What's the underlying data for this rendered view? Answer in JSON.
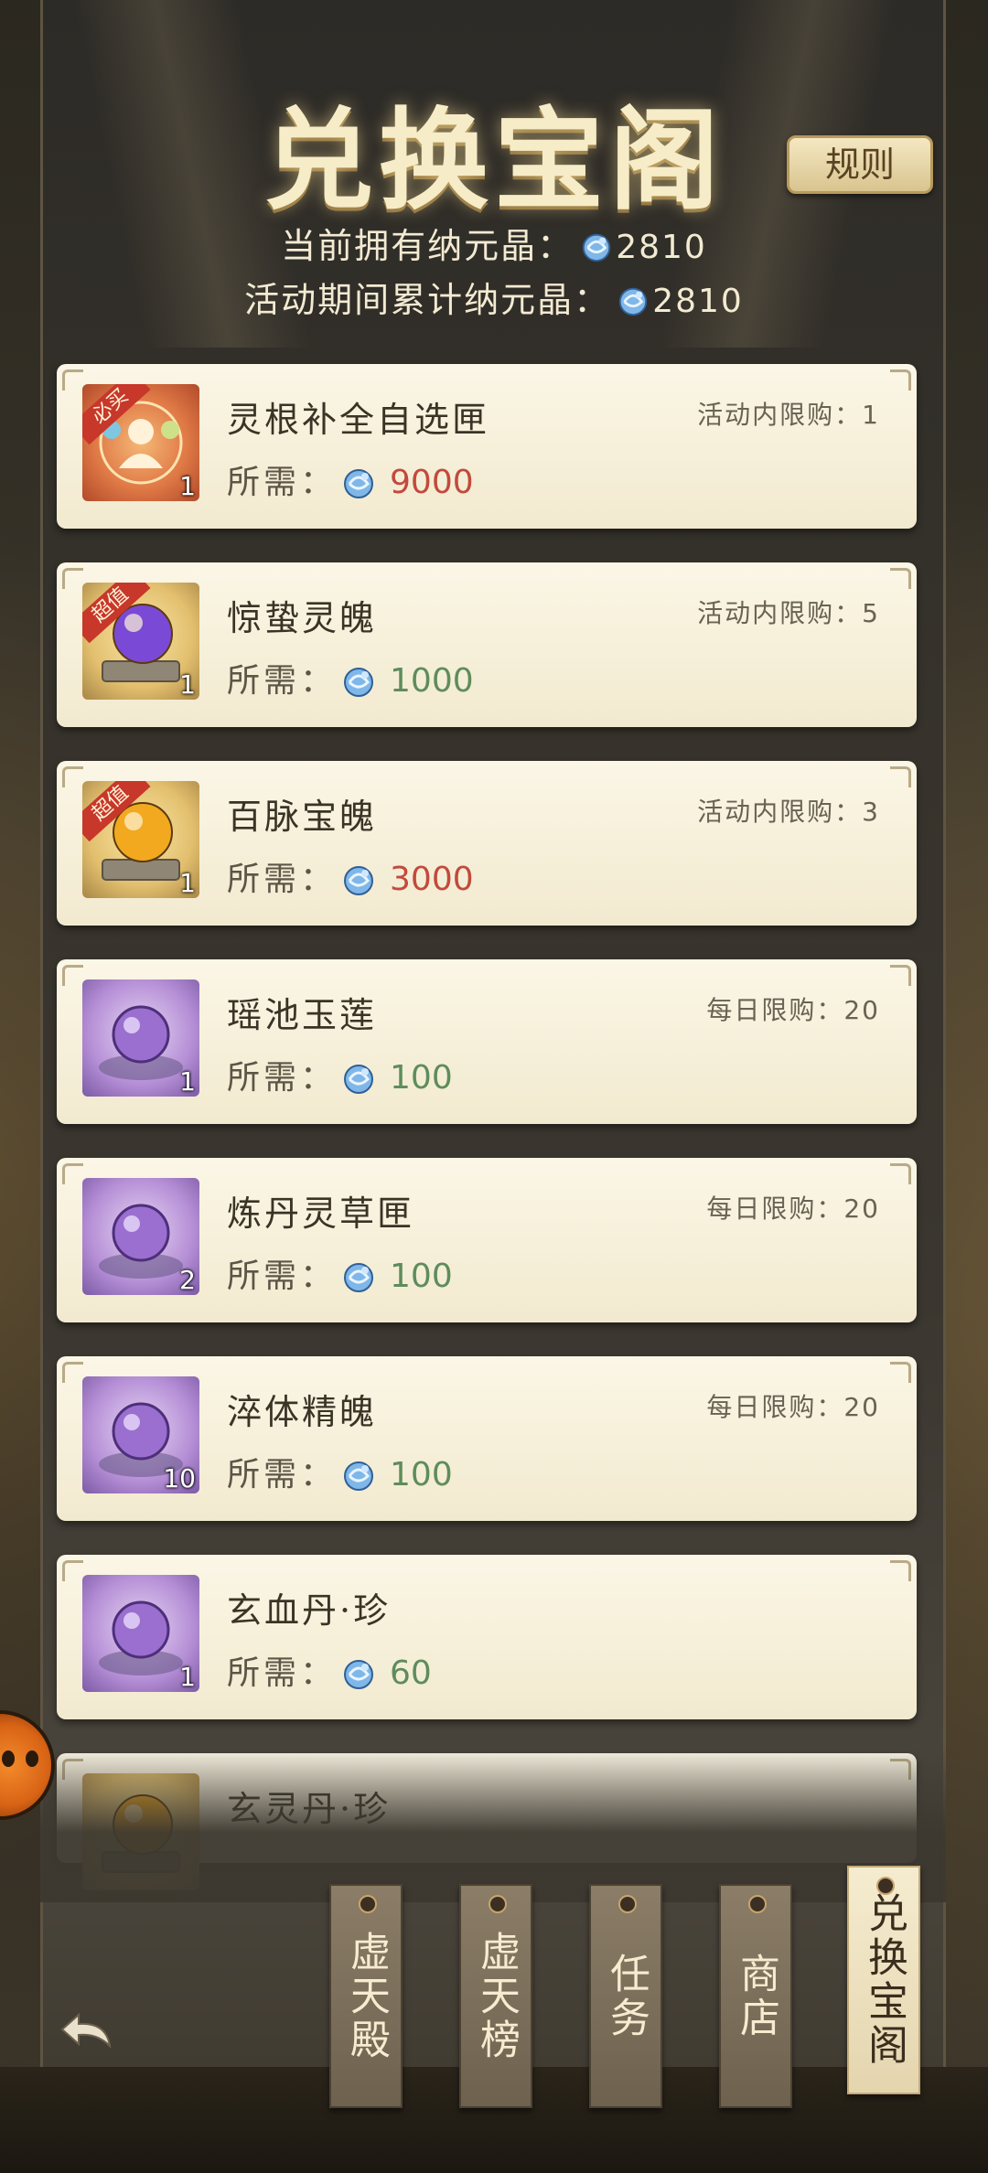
{
  "header": {
    "title": "兑换宝阁",
    "rules_label": "规则",
    "current_label": "当前拥有纳元晶：",
    "current_value": "2810",
    "total_label": "活动期间累计纳元晶：",
    "total_value": "2810"
  },
  "need_label": "所需：",
  "items": [
    {
      "name": "灵根补全自选匣",
      "price": "9000",
      "price_color": "red",
      "limit_label": "活动内限购：",
      "limit": "1",
      "count": "1",
      "tag": "必买",
      "thumb": "red"
    },
    {
      "name": "惊蛰灵魄",
      "price": "1000",
      "price_color": "green",
      "limit_label": "活动内限购：",
      "limit": "5",
      "count": "1",
      "tag": "超值",
      "thumb": "gold"
    },
    {
      "name": "百脉宝魄",
      "price": "3000",
      "price_color": "red",
      "limit_label": "活动内限购：",
      "limit": "3",
      "count": "1",
      "tag": "超值",
      "thumb": "gold"
    },
    {
      "name": "瑶池玉莲",
      "price": "100",
      "price_color": "green",
      "limit_label": "每日限购：",
      "limit": "20",
      "count": "1",
      "tag": "",
      "thumb": "purple"
    },
    {
      "name": "炼丹灵草匣",
      "price": "100",
      "price_color": "green",
      "limit_label": "每日限购：",
      "limit": "20",
      "count": "2",
      "tag": "",
      "thumb": "purple"
    },
    {
      "name": "淬体精魄",
      "price": "100",
      "price_color": "green",
      "limit_label": "每日限购：",
      "limit": "20",
      "count": "10",
      "tag": "",
      "thumb": "purple"
    },
    {
      "name": "玄血丹·珍",
      "price": "60",
      "price_color": "green",
      "limit_label": "",
      "limit": "",
      "count": "1",
      "tag": "",
      "thumb": "purple"
    },
    {
      "name": "玄灵丹·珍",
      "price": "",
      "price_color": "green",
      "limit_label": "",
      "limit": "",
      "count": "",
      "tag": "",
      "thumb": "gold"
    }
  ],
  "nav": [
    {
      "label": "虚天殿",
      "active": false
    },
    {
      "label": "虚天榜",
      "active": false
    },
    {
      "label": "任务",
      "active": false
    },
    {
      "label": "商店",
      "active": false
    },
    {
      "label": "兑换宝阁",
      "active": true
    }
  ],
  "colors": {
    "price_red": "#c24a3c",
    "price_green": "#5f8c5c",
    "card_bg": "#f7f0da",
    "title_glow": "#f6ecc8"
  },
  "icons": {
    "currency": "blue-dragon-gem-icon",
    "back": "back-arrow-icon"
  }
}
